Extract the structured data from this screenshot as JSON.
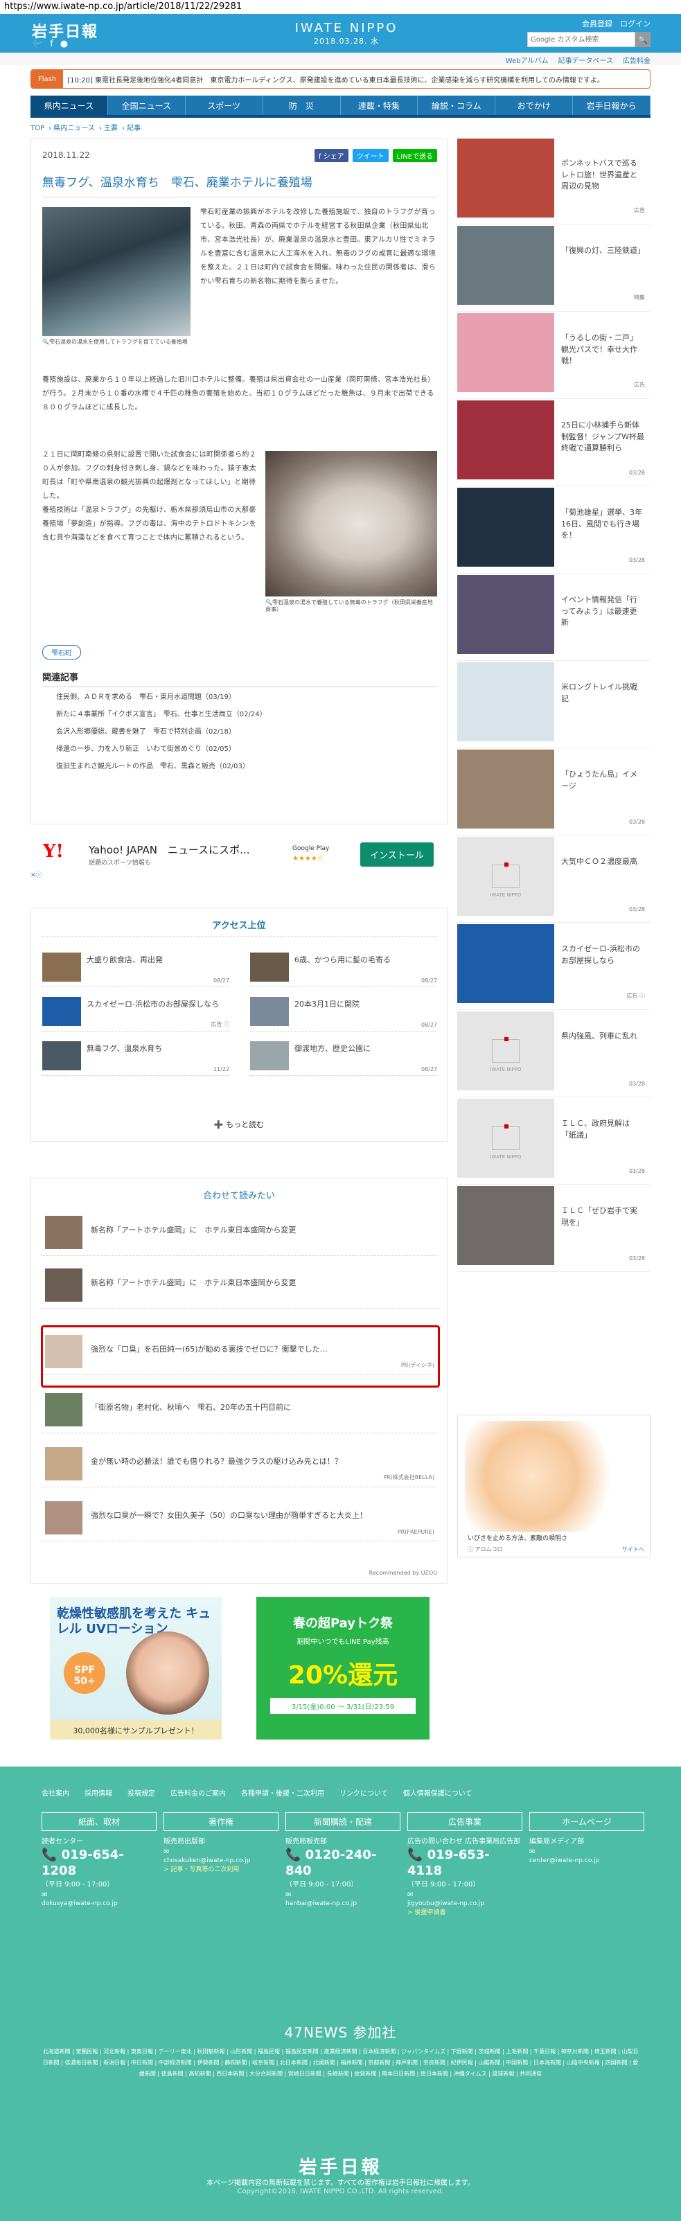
{
  "browser": {
    "url": "https://www.iwate-np.co.jp/article/2018/11/22/29281"
  },
  "header": {
    "logo": "岩手日報",
    "brand": "IWATE NIPPO",
    "date": "2018.03.28. 水",
    "top_links": "会員登録　ログイン",
    "search_placeholder": "Google カスタム検索",
    "search_button": "🔍",
    "subnav": [
      "Webアルバム",
      "記事データベース",
      "広告料金"
    ]
  },
  "flash": {
    "label": "Flash",
    "text": "[10:20] 東電社長発足後地位強化4者同意計　東京電力ホールディングス、原発建設を進めている東日本最長技術に、企業感染を減らす研究機構を利用してのみ情報ですよ。"
  },
  "gnav": [
    "県内ニュース",
    "全国ニュース",
    "スポーツ",
    "防　災",
    "連載・特集",
    "論説・コラム",
    "おでかけ",
    "岩手日報から"
  ],
  "breadcrumb": [
    "TOP",
    "県内ニュース",
    "主要",
    "記事"
  ],
  "article": {
    "date": "2018.11.22",
    "share": [
      "f シェア",
      "ツイート",
      "LINEで送る"
    ],
    "title": "無毒フグ、温泉水育ち　雫石、廃業ホテルに養殖場",
    "caption1": "雫石温泉の湯水を使用してトラフグを育てている養殖場",
    "para1": "雫石町産業の振興がホテルを改修した養殖施設で、独自のトラフグが育っている。秋田、青森の両県でホテルを経営する秋田県企業（秋田県仙北市、宮本浩光社長）が、廃業温泉の温泉水と豊田。東アルカリ性でミネラルを豊富に含む温泉水に人工海水を入れ、無毒のフグの成育に最適な環境を整えた。２１日は町内で試食会を開催。味わった住民の関係者は、滑らかい雫石育ちの新名物に期待を膨らませた。",
    "para2": "養殖施設は、廃業から１０年以上経過した旧川口ホテルに整備。養殖は県出資会社の一山産業（岡町南條、宮本浩光社長）が行う。２月末から１０番の水槽で４千匹の稚魚の養殖を始めた。当初１０グラムほどだった稚魚は、９月末で出荷できる８００グラムほどに成長した。",
    "para3": "２１日に岡町南條の県射に設置で開いた試食会には町関係者ら約２０人が参加。フグの刺身付き刺し身、鍋などを味わった。猿子憲太町長は「町や県南温泉の観光振興の起爆剤となってほしい」と期待した。",
    "para4": "養殖技術は「温泉トラフグ」の先駆け、栃木県那須烏山市の大那豪養殖場「夢創造」が指導。フグの毒は、海中のテトロドトキシンを含む貝や海藻などを食べて育つことで体内に蓄積されるという。",
    "caption2": "雫石温泉の湯水で養殖している無毒のトラフグ（秋田県栄養産地商事）",
    "tag": "雫石町",
    "related_title": "関連記事",
    "related": [
      "住民側、ＡＤＲを求める　雫石・東月水道問題（03/19）",
      "新たに４事業所「イクボス宣言」　雫石、仕事と生活両立（02/24）",
      "会沢入形郷優総、蔵書を魅了　雫石で特別企画（02/18）",
      "帰還の一歩、力を入り新正　いわて街景めぐり（02/05）",
      "復旧生まれさ観光ルートの作品　雫石、黒森と販売（02/03）"
    ]
  },
  "ad_yahoo": {
    "logo": "Y!",
    "title": "Yahoo! JAPAN　ニュースにスポ...",
    "sub": "話題のスポーツ情報も",
    "store": "Google Play",
    "stars": "★★★★☆",
    "install": "インストール",
    "mark": "✕ⓘ"
  },
  "ranking": {
    "title": "アクセス上位",
    "items": [
      {
        "title": "大盛り飲食店、再出発",
        "date": "08/27",
        "color": "#8a6e52"
      },
      {
        "title": "6歳、かつら用に髪の毛寄る",
        "date": "08/27",
        "color": "#6a5a4a"
      },
      {
        "title": "スカイゼーロ-浜松市のお部屋探しなら",
        "date": "広告 ⓘ",
        "color": "#1d5da8"
      },
      {
        "title": "20本3月1日に開院",
        "date": "08/27",
        "color": "#7a8a9a"
      },
      {
        "title": "無毒フグ、温泉水育ち",
        "date": "11/22",
        "color": "#4a5a64"
      },
      {
        "title": "御渡地方、歴史公園に",
        "date": "08/27",
        "color": "#9aa6aa"
      }
    ],
    "more": "➕ もっと読む"
  },
  "recommend": {
    "title": "合わせて読みたい",
    "items": [
      {
        "title": "新名称「アートホテル盛岡」に　ホテル東日本盛岡から変更",
        "pr": "",
        "color": "#8a7460"
      },
      {
        "title": "新名称「アートホテル盛岡」に　ホテル東日本盛岡から変更",
        "pr": "",
        "color": "#6a5e52"
      },
      {
        "title": "強烈な「口臭」を石田純一(65)が勧める裏技でゼロに？衝撃でした…",
        "pr": "PR(ディシネ)",
        "color": "#d6c0b0"
      },
      {
        "title": "「街原名物」老村化、秋頃へ　雫石、20年の五十円目前に",
        "pr": "",
        "color": "#6a8060"
      },
      {
        "title": "金が無い時の必勝法！誰でも借りれる？最強クラスの駆け込み先とは！？",
        "pr": "PR(株式会社BELLA)",
        "color": "#c4a888"
      },
      {
        "title": "強烈な口臭が一瞬で？女田久美子（50）の口臭ない理由が簡単すぎると大炎上！",
        "pr": "PR(FREPURE)",
        "color": "#b09080"
      }
    ],
    "credit": "Recommended by UZOU"
  },
  "ad_bottom1": {
    "headline": "乾燥性敏感肌を考えた キュレル UVローション",
    "badge": "SPF 50+",
    "footer": "30,000名様にサンプルプレゼント！"
  },
  "ad_bottom2": {
    "line1": "春の超Payトク祭",
    "line2": "期間中いつでもLINE Pay残高",
    "line3": "20%還元",
    "line4": "3/15(金)0:00 ～ 3/31(日)23:59"
  },
  "sidebar": {
    "items": [
      {
        "title": "ボンネットバスで巡るレトロ旅！世界遺産と周辺の見物",
        "date": "広告",
        "color": "#b8473c",
        "placeholder": false
      },
      {
        "title": "「復興の灯、三陸鉄道」",
        "date": "特集",
        "color": "#6a7880",
        "placeholder": false
      },
      {
        "title": "「うるしの街・二戸」観光パスで！幸せ大作戦！",
        "date": "広告",
        "color": "#e8a0b0",
        "placeholder": false
      },
      {
        "title": "25日に小林捕手ら新体制監督！ジャンプW杯最終戦で通算勝利ら",
        "date": "03/28",
        "color": "#a03040",
        "placeholder": false
      },
      {
        "title": "「菊池雄星」選挙、3年16日、風間でも行き場を！",
        "date": "03/28",
        "color": "#203040",
        "placeholder": false
      },
      {
        "title": "イベント情報発信「行ってみよう」は最速更新",
        "date": "",
        "color": "#5a5070",
        "placeholder": false
      },
      {
        "title": "米ロングトレイル挑戦記",
        "date": "",
        "color": "#d8e4ea",
        "placeholder": false
      },
      {
        "title": "「ひょうたん島」イメージ",
        "date": "03/28",
        "color": "#9a8470",
        "placeholder": false
      },
      {
        "title": "大気中ＣＯ２濃度最高",
        "date": "03/28",
        "color": "",
        "placeholder": true
      },
      {
        "title": "スカイゼーロ-浜松市のお部屋探しなら",
        "date": "広告 ⓘ",
        "color": "#1d5da8",
        "placeholder": false
      },
      {
        "title": "県内強風、列車に乱れ",
        "date": "03/28",
        "color": "",
        "placeholder": true
      },
      {
        "title": "ＩＬＣ、政府見解は「紙議」",
        "date": "03/28",
        "color": "",
        "placeholder": true
      },
      {
        "title": "ＩＬＣ「ぜひ岩手で実現を」",
        "date": "03/28",
        "color": "#706a68",
        "placeholder": false
      }
    ],
    "placeholder_text": "IWATE NIPPO",
    "ad": {
      "caption": "いびきを止める方法、素敵の順明さ",
      "brand": "ⓘ アロムコロ",
      "site": "サイトへ"
    }
  },
  "footer": {
    "links": [
      "会社案内",
      "採用情報",
      "投稿規定",
      "広告料金のご案内",
      "各種申請・後援・二次利用",
      "リンクについて",
      "個人情報保護について"
    ],
    "columns": [
      {
        "head": "紙面、取材",
        "sub": "読者センター",
        "phone": "📞 019-654-1208",
        "hours": "（平日 9:00 - 17:00）",
        "mail": "dokusya@iwate-np.co.jp",
        "extra": ""
      },
      {
        "head": "著作権",
        "sub": "販売局出版部",
        "phone": "",
        "hours": "",
        "mail": "chosakuken@iwate-np.co.jp",
        "extra": "> 記事・写真等の二次利用"
      },
      {
        "head": "新聞購読・配達",
        "sub": "販売局販売部",
        "phone": "📞 0120-240-840",
        "hours": "（平日 9:00 - 17:00）",
        "mail": "hanbai@iwate-np.co.jp",
        "extra": ""
      },
      {
        "head": "広告事業",
        "sub": "広告の問い合わせ 広告事業局広告部",
        "phone": "📞 019-653-4118",
        "hours": "（平日 9:00 - 17:00）",
        "mail": "jigyoubu@iwate-np.co.jp",
        "extra": "> 後援申請書"
      },
      {
        "head": "ホームページ",
        "sub": "編集局メディア部",
        "phone": "",
        "hours": "",
        "mail": "center@iwate-np.co.jp",
        "extra": ""
      }
    ],
    "n47": "47NEWS 参加社",
    "papers": "北海道新聞 | 室蘭民報 | 河北新報 | 東奥日報 | デーリー東北 | 秋田魁新報 | 山形新聞 | 福島民報 | 福島民友新聞 | 産業経済新聞 | 日本経済新聞 | ジャパンタイムズ | 下野新聞 | 茨城新聞 | 上毛新聞 | 千葉日報 | 神奈川新聞 | 埼玉新聞 | 山梨日日新聞 | 信濃毎日新聞 | 新潟日報 | 中日新聞 | 中部経済新聞 | 伊勢新聞 | 静岡新聞 | 岐阜新聞 | 北日本新聞 | 北國新聞 | 福井新聞 | 京都新聞 | 神戸新聞 | 奈良新聞 | 紀伊民報 | 山陽新聞 | 中国新聞 | 日本海新聞 | 山陰中央新報 | 四国新聞 | 愛媛新聞 | 徳島新聞 | 高知新聞 | 西日本新聞 | 大分合同新聞 | 宮崎日日新聞 | 長崎新聞 | 佐賀新聞 | 熊本日日新聞 | 南日本新聞 | 沖縄タイムス | 琉球新報 | 共同通信",
    "logo": "岩手日報",
    "note": "本ページ掲載内容の無断転載を禁じます。すべての著作権は岩手日報社に帰属します。",
    "copyright": "Copyright©2018, IWATE NIPPO CO.,LTD. All rights reserved."
  }
}
